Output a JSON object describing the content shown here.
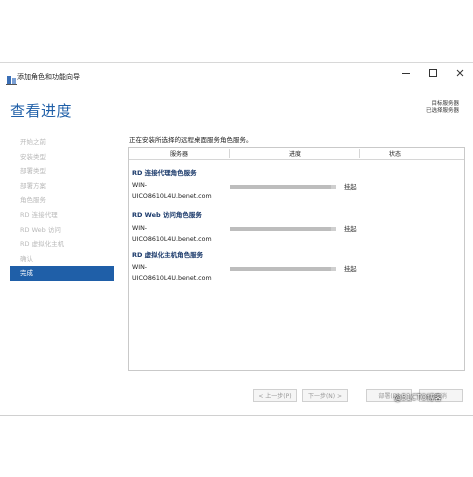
{
  "window": {
    "title": "添加角色和功能向导",
    "min_icon": "minimize-icon",
    "max_icon": "maximize-icon",
    "close_icon": "close-icon"
  },
  "header": {
    "title": "查看进度",
    "server_line1": "目标服务器",
    "server_line2": "已选择服务器"
  },
  "nav": {
    "items": [
      {
        "label": "开始之前"
      },
      {
        "label": "安装类型"
      },
      {
        "label": "部署类型"
      },
      {
        "label": "部署方案"
      },
      {
        "label": "角色服务"
      },
      {
        "label": "RD 连接代理"
      },
      {
        "label": "RD Web 访问"
      },
      {
        "label": "RD 虚拟化主机"
      },
      {
        "label": "确认"
      },
      {
        "label": "完成"
      }
    ],
    "active_index": 9
  },
  "main": {
    "intro": "正在安装所选择的远程桌面服务角色服务。",
    "columns": [
      "服务器",
      "进度",
      "状态"
    ],
    "groups": [
      {
        "title": "RD 连接代理角色服务",
        "server_line1": "WIN-",
        "server_line2": "UICO8610L4U.benet.com",
        "progress": 0.95,
        "status": "挂起"
      },
      {
        "title": "RD Web 访问角色服务",
        "server_line1": "WIN-",
        "server_line2": "UICO8610L4U.benet.com",
        "progress": 0.95,
        "status": "挂起"
      },
      {
        "title": "RD 虚拟化主机角色服务",
        "server_line1": "WIN-",
        "server_line2": "UICO8610L4U.benet.com",
        "progress": 0.95,
        "status": "挂起"
      }
    ]
  },
  "footer": {
    "prev": "< 上一步(P)",
    "next": "下一步(N) >",
    "deploy": "部署(D)",
    "cancel": "取消"
  },
  "watermark": "@51CTO博客",
  "colors": {
    "accent": "#1f5fa8",
    "nav_inactive": "#b9b9b9",
    "group_title": "#1b3a6b"
  }
}
